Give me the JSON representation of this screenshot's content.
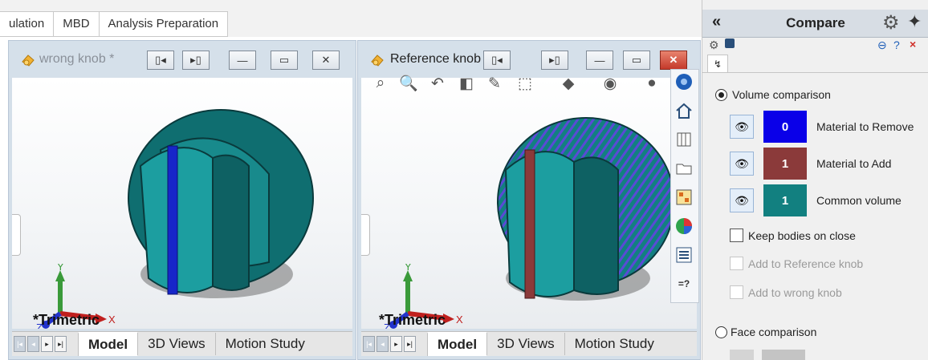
{
  "tabs": [
    "ulation",
    "MBD",
    "Analysis Preparation"
  ],
  "left_window": {
    "title": "wrong knob *",
    "view_label": "*Trimetric",
    "bottom_tabs": [
      "Model",
      "3D Views",
      "Motion Study"
    ],
    "axis_labels": {
      "y": "Y",
      "x": "X",
      "z": "Z"
    }
  },
  "right_window": {
    "title": "Reference knob",
    "view_label": "*Trimetric",
    "bottom_tabs": [
      "Model",
      "3D Views",
      "Motion Study"
    ],
    "axis_labels": {
      "y": "Y",
      "x": "X",
      "z": "Z"
    }
  },
  "side_toolbar": {
    "help_label": "=?"
  },
  "panel": {
    "collapse_label": "«",
    "title": "Compare",
    "volume_comparison": {
      "label": "Volume comparison",
      "selected": true,
      "items": [
        {
          "count": "0",
          "label": "Material to Remove",
          "color": "#0a00e8"
        },
        {
          "count": "1",
          "label": "Material to Add",
          "color": "#8b3a3a"
        },
        {
          "count": "1",
          "label": "Common volume",
          "color": "#128080"
        }
      ]
    },
    "keep_bodies": "Keep bodies on close",
    "add_to_reference": "Add to Reference knob",
    "add_to_wrong": "Add to wrong knob",
    "face_comparison": "Face comparison"
  }
}
